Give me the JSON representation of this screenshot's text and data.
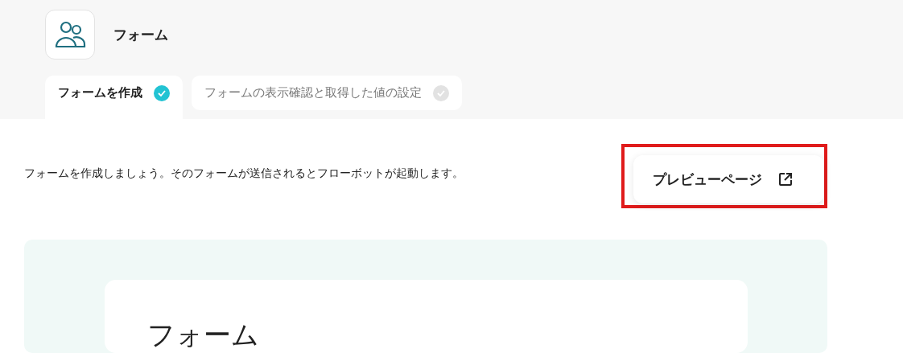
{
  "header": {
    "title": "フォーム"
  },
  "tabs": [
    {
      "label": "フォームを作成",
      "selected": true,
      "done": true
    },
    {
      "label": "フォームの表示確認と取得した値の設定",
      "selected": false,
      "done": false
    }
  ],
  "description": "フォームを作成しましょう。そのフォームが送信されるとフローボットが起動します。",
  "preview_button": {
    "label": "プレビューページ",
    "highlighted": true
  },
  "form_preview": {
    "title": "フォーム"
  }
}
